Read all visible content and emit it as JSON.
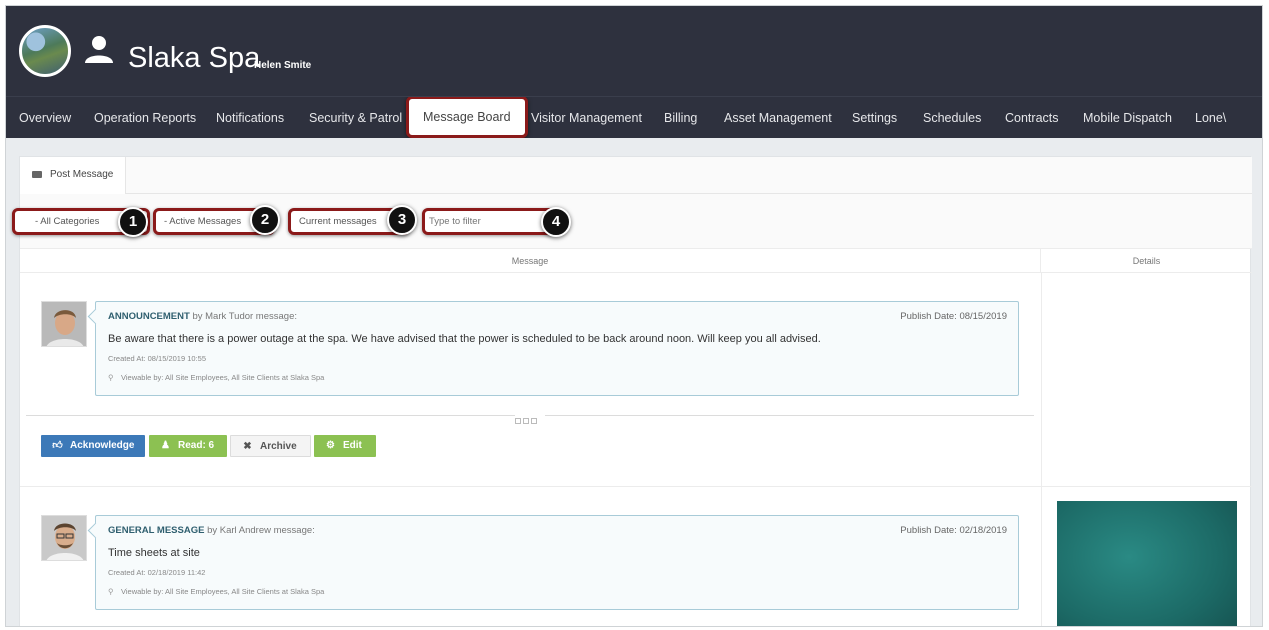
{
  "header": {
    "site_title": "Slaka Spa",
    "user_name": "Helen Smite",
    "logo_icon": "site-logo",
    "user_icon": "person-icon"
  },
  "nav": {
    "items": [
      {
        "label": "Overview"
      },
      {
        "label": "Operation Reports"
      },
      {
        "label": "Notifications"
      },
      {
        "label": "Security & Patrol"
      },
      {
        "label": "Message Board",
        "active": true
      },
      {
        "label": "Visitor Management"
      },
      {
        "label": "Billing"
      },
      {
        "label": "Asset Management"
      },
      {
        "label": "Settings"
      },
      {
        "label": "Schedules"
      },
      {
        "label": "Contracts"
      },
      {
        "label": "Mobile Dispatch"
      },
      {
        "label": "Lone\\"
      }
    ]
  },
  "tabs": {
    "post_message": "Post Message"
  },
  "filters": {
    "category": "- All Categories",
    "status": "- Active Messages",
    "period": "Current messages",
    "search_placeholder": "Type to filter",
    "badges": [
      "1",
      "2",
      "3",
      "4"
    ]
  },
  "columns": {
    "message": "Message",
    "details": "Details"
  },
  "messages": [
    {
      "category": "ANNOUNCEMENT",
      "by": "by Mark Tudor message:",
      "publish": "Publish Date: 08/15/2019",
      "body": "Be aware that there is a power outage at the spa. We have advised that the power is scheduled to be back around noon. Will keep you all advised.",
      "created": "Created At: 08/15/2019 10:55",
      "viewable": "Viewable by: All Site Employees, All Site Clients at Slaka Spa"
    },
    {
      "category": "GENERAL MESSAGE",
      "by": "by Karl Andrew message:",
      "publish": "Publish Date: 02/18/2019",
      "body": "Time sheets at site",
      "created": "Created At: 02/18/2019 11:42",
      "viewable": "Viewable by: All Site Employees, All Site Clients at Slaka Spa"
    }
  ],
  "actions": {
    "acknowledge": "Acknowledge",
    "read": "Read: 6",
    "archive": "Archive",
    "edit": "Edit"
  },
  "colors": {
    "header_bg": "#2e313e",
    "highlight": "#8b1a1a",
    "blue_btn": "#3c79b8",
    "green_btn": "#8cc152"
  }
}
